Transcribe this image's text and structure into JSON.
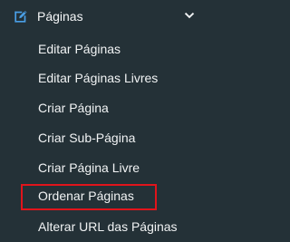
{
  "menu": {
    "section": {
      "icon": "edit-square-icon",
      "label": "Páginas",
      "chevron": "chevron-down-icon",
      "expanded": true
    },
    "items": [
      {
        "label": "Editar Páginas"
      },
      {
        "label": "Editar Páginas Livres"
      },
      {
        "label": "Criar Página"
      },
      {
        "label": "Criar Sub-Página"
      },
      {
        "label": "Criar Página Livre"
      },
      {
        "label": "Ordenar Páginas",
        "highlighted": true,
        "highlight_color": "#e1141b"
      },
      {
        "label": "Alterar URL das Páginas"
      }
    ]
  },
  "colors": {
    "background": "#243137",
    "text": "#f1f3f4",
    "icon_accent": "#4a9fe6",
    "highlight": "#e1141b"
  }
}
